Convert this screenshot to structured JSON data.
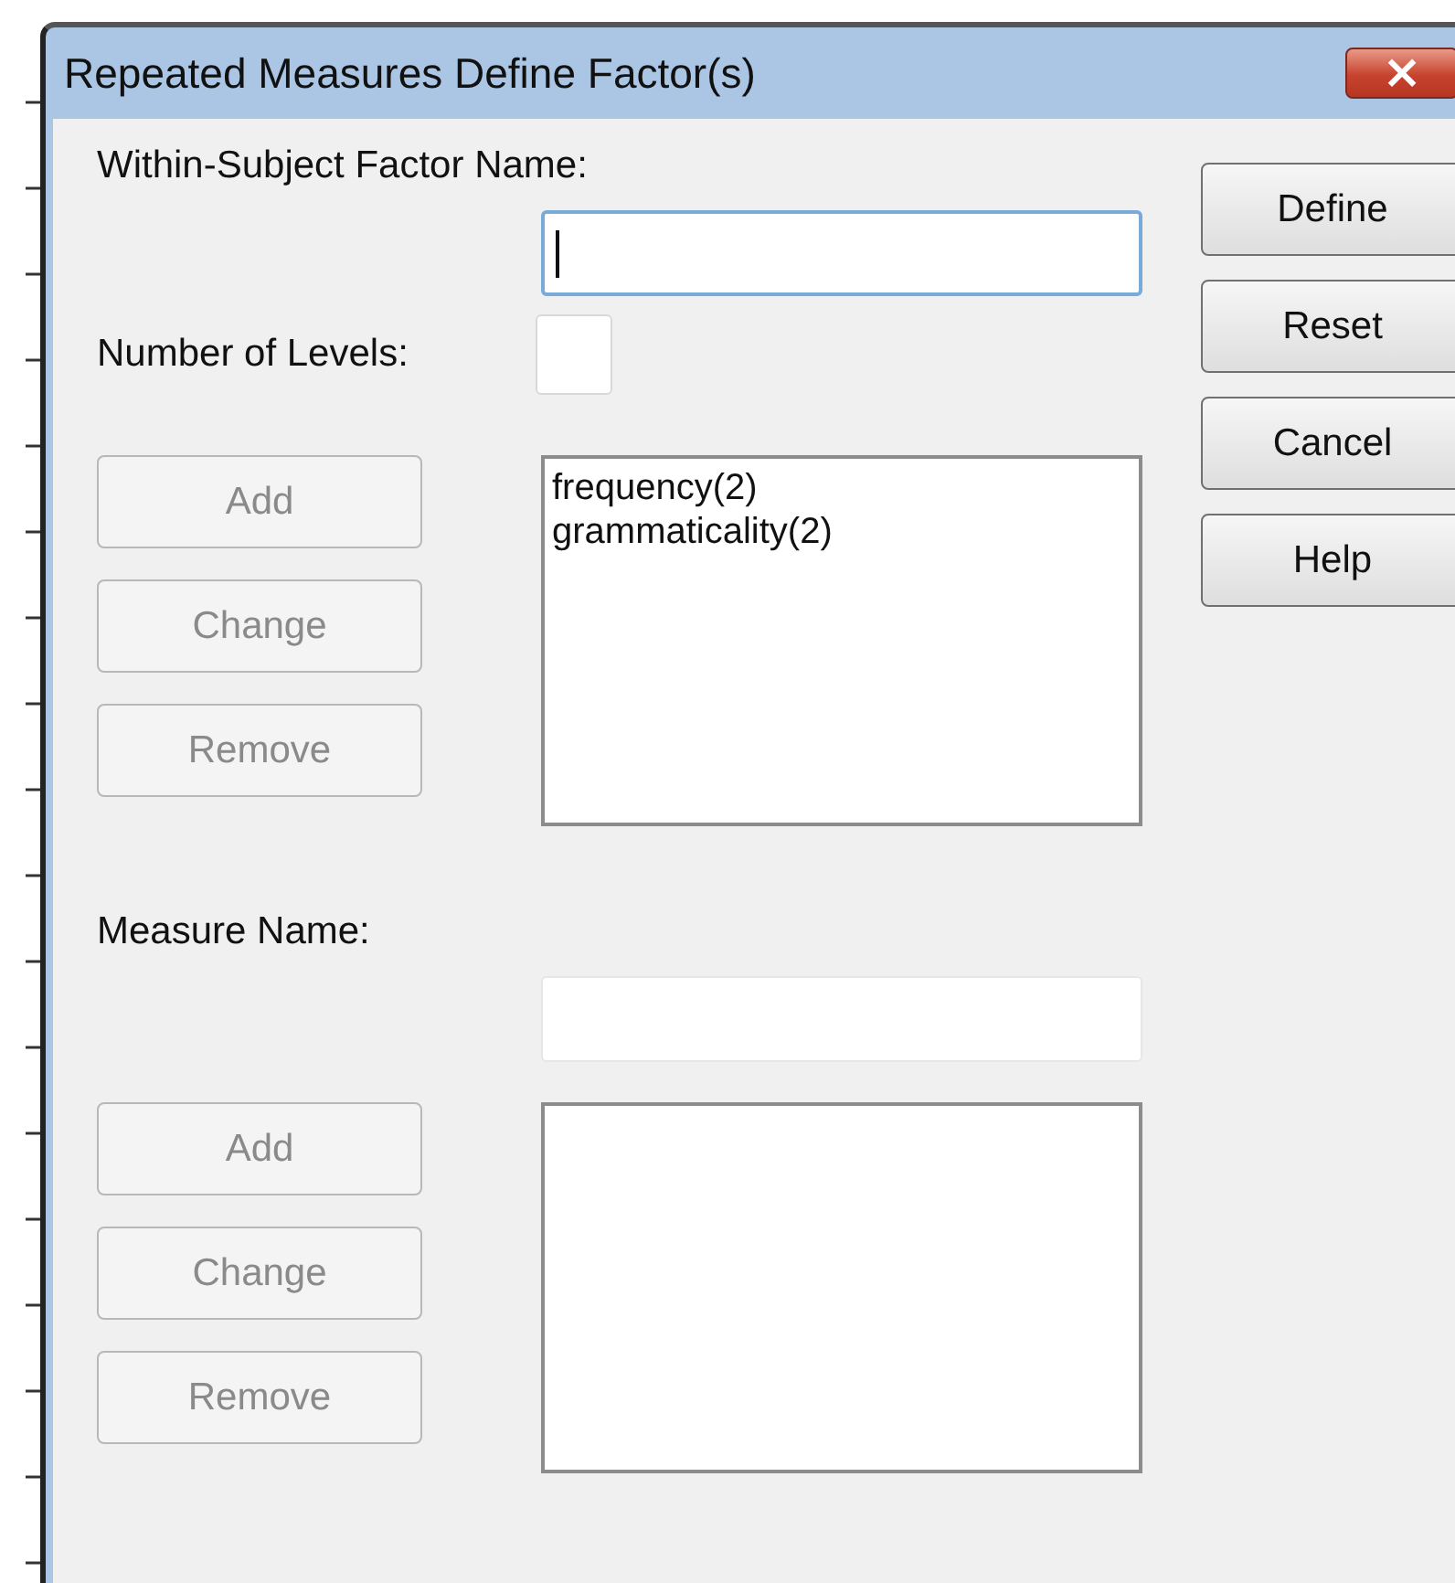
{
  "window": {
    "title": "Repeated Measures Define Factor(s)",
    "close_icon": "×"
  },
  "factor_section": {
    "name_label": "Within-Subject Factor Name:",
    "name_field": {
      "focused": true
    },
    "levels_label": "Number of Levels:",
    "levels_field": {
      "focused": false
    },
    "buttons": [
      {
        "label": "Add",
        "disabled": true
      },
      {
        "label": "Change",
        "disabled": true
      },
      {
        "label": "Remove",
        "disabled": true
      }
    ],
    "list": [
      "frequency(2)",
      "grammaticality(2)"
    ]
  },
  "measure_section": {
    "name_label": "Measure Name:",
    "name_field": {
      "focused": false
    },
    "buttons": [
      {
        "label": "Add",
        "disabled": true
      },
      {
        "label": "Change",
        "disabled": true
      },
      {
        "label": "Remove",
        "disabled": true
      }
    ]
  },
  "side_buttons": [
    {
      "label": "Define",
      "disabled": false
    },
    {
      "label": "Reset",
      "disabled": false
    },
    {
      "label": "Cancel",
      "disabled": false
    },
    {
      "label": "Help",
      "disabled": false
    }
  ]
}
